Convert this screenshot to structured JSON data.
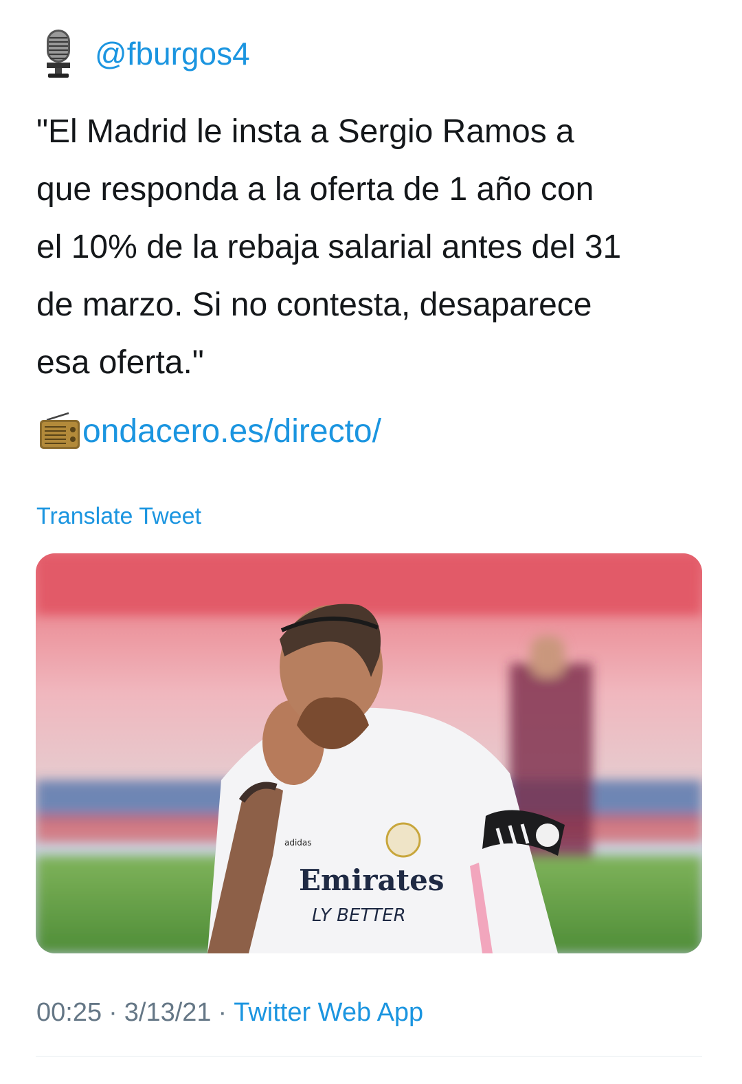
{
  "tweet": {
    "mention": "@fburgos4",
    "mention_icon": "microphone-icon",
    "text": "\"El Madrid le insta a Sergio Ramos a\nque responda a la oferta de 1 año con\nel 10% de la rebaja salarial antes del 31\nde marzo. Si no contesta, desaparece\nesa oferta.\"",
    "link_icon": "radio-icon",
    "link_text": "ondacero.es/directo/",
    "translate_label": "Translate Tweet",
    "media": {
      "jersey_sponsor_line1": "Emirates",
      "jersey_sponsor_line2": "LY BETTER",
      "jersey_brand": "adidas"
    },
    "time": "00:25",
    "date": "3/13/21",
    "source": "Twitter Web App",
    "separator": "·"
  },
  "colors": {
    "link": "#1b95e0",
    "text": "#14171a",
    "meta": "#657786"
  }
}
